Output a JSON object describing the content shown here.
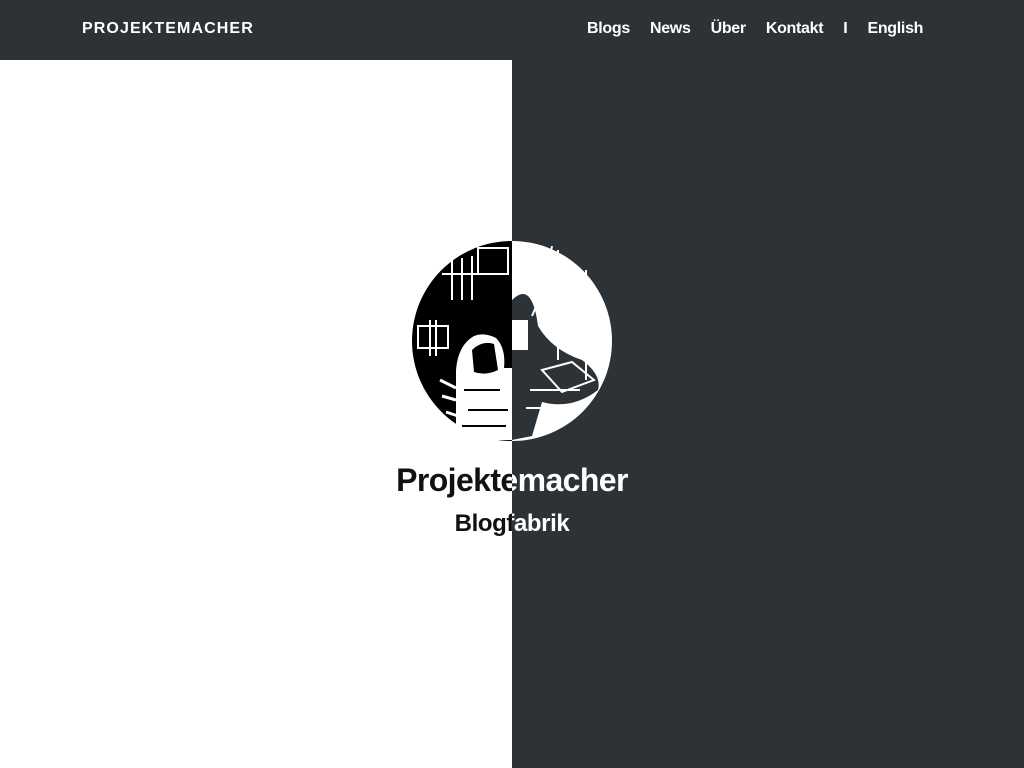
{
  "header": {
    "brand": "PROJEKTEMACHER",
    "nav": {
      "blogs": "Blogs",
      "news": "News",
      "about": "Über",
      "contact": "Kontakt",
      "separator": "I",
      "language": "English"
    }
  },
  "hero": {
    "title": "Projektemacher",
    "subtitle": "Blogfabrik",
    "logo_icon": "workshop-illustration-icon"
  },
  "colors": {
    "dark": "#2c3235",
    "light": "#ffffff"
  }
}
